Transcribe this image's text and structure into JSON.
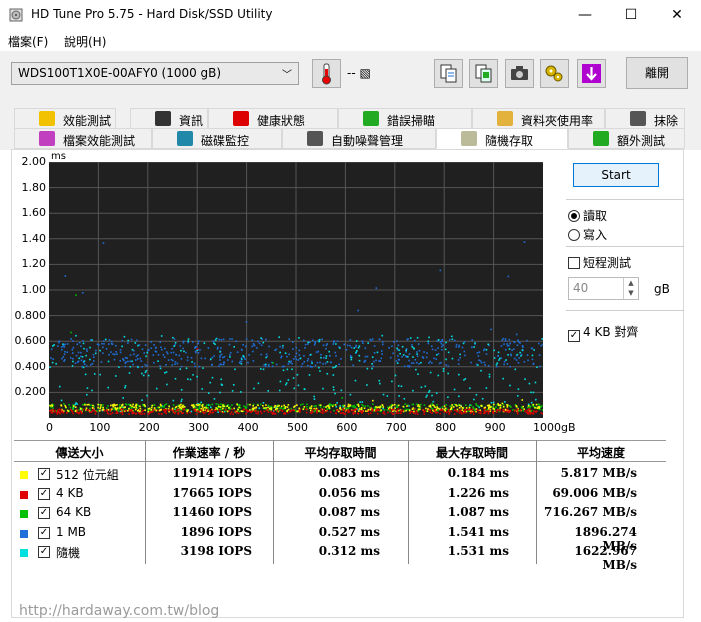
{
  "window": {
    "title": "HD Tune Pro 5.75 - Hard Disk/SSD Utility",
    "minimize": "—",
    "maximize": "☐",
    "close": "✕"
  },
  "menu": {
    "file": "檔案(F)",
    "help": "說明(H)"
  },
  "toolbar": {
    "drive": "WDS100T1X0E-00AFY0 (1000 gB)",
    "temperature": "-- ▧",
    "exit_label": "離開"
  },
  "tabs_row1": [
    "效能測試",
    "資訊",
    "健康狀態",
    "錯誤掃瞄",
    "資料夾使用率",
    "抹除"
  ],
  "tabs_row2": [
    "檔案效能測試",
    "磁碟監控",
    "自動噪聲管理",
    "隨機存取",
    "額外測試"
  ],
  "active_tab": "隨機存取",
  "controls": {
    "start_label": "Start",
    "read_label": "讀取",
    "write_label": "寫入",
    "read_selected": true,
    "short_test_label": "短程測試",
    "short_test_checked": false,
    "short_test_value": "40",
    "short_test_unit": "gB",
    "align_label": "4 KB 對齊",
    "align_checked": true
  },
  "colors": {
    "s512": "#ffff00",
    "s4k": "#e00000",
    "s64k": "#00c000",
    "s1m": "#1e6fd9",
    "rnd": "#00e0e0",
    "plot_bg": "#202020",
    "grid": "#555555"
  },
  "chart_data": {
    "type": "scatter",
    "ylabel": "ms",
    "xlabel_suffix": "gB",
    "ylim": [
      0,
      2.0
    ],
    "xlim": [
      0,
      1000
    ],
    "yticks": [
      "2.00",
      "1.80",
      "1.60",
      "1.40",
      "1.20",
      "1.00",
      "0.800",
      "0.600",
      "0.400",
      "0.200"
    ],
    "xticks": [
      "0",
      "100",
      "200",
      "300",
      "400",
      "500",
      "600",
      "700",
      "800",
      "900",
      "1000gB"
    ],
    "series": [
      {
        "name": "512 位元組",
        "color": "#ffff00",
        "avg": 0.083,
        "max": 0.184
      },
      {
        "name": "4 KB",
        "color": "#e00000",
        "avg": 0.056,
        "max": 1.226
      },
      {
        "name": "64 KB",
        "color": "#00c000",
        "avg": 0.087,
        "max": 1.087
      },
      {
        "name": "1 MB",
        "color": "#1e6fd9",
        "avg": 0.527,
        "max": 1.541
      },
      {
        "name": "隨機",
        "color": "#00e0e0",
        "avg": 0.312,
        "max": 1.531
      }
    ]
  },
  "table": {
    "headers": [
      "傳送大小",
      "作業速率 / 秒",
      "平均存取時間",
      "最大存取時間",
      "平均速度"
    ],
    "rows": [
      {
        "label": "512 位元組",
        "color": "#ffff00",
        "iops": "11914 IOPS",
        "avg": "0.083 ms",
        "max": "0.184 ms",
        "speed": "5.817 MB/s"
      },
      {
        "label": "4 KB",
        "color": "#e00000",
        "iops": "17665 IOPS",
        "avg": "0.056 ms",
        "max": "1.226 ms",
        "speed": "69.006 MB/s"
      },
      {
        "label": "64 KB",
        "color": "#00c000",
        "iops": "11460 IOPS",
        "avg": "0.087 ms",
        "max": "1.087 ms",
        "speed": "716.267 MB/s"
      },
      {
        "label": "1 MB",
        "color": "#1e6fd9",
        "iops": "1896 IOPS",
        "avg": "0.527 ms",
        "max": "1.541 ms",
        "speed": "1896.274 MB/s"
      },
      {
        "label": "隨機",
        "color": "#00e0e0",
        "iops": "3198 IOPS",
        "avg": "0.312 ms",
        "max": "1.531 ms",
        "speed": "1622.967 MB/s"
      }
    ]
  },
  "watermark": "http://hardaway.com.tw/blog"
}
